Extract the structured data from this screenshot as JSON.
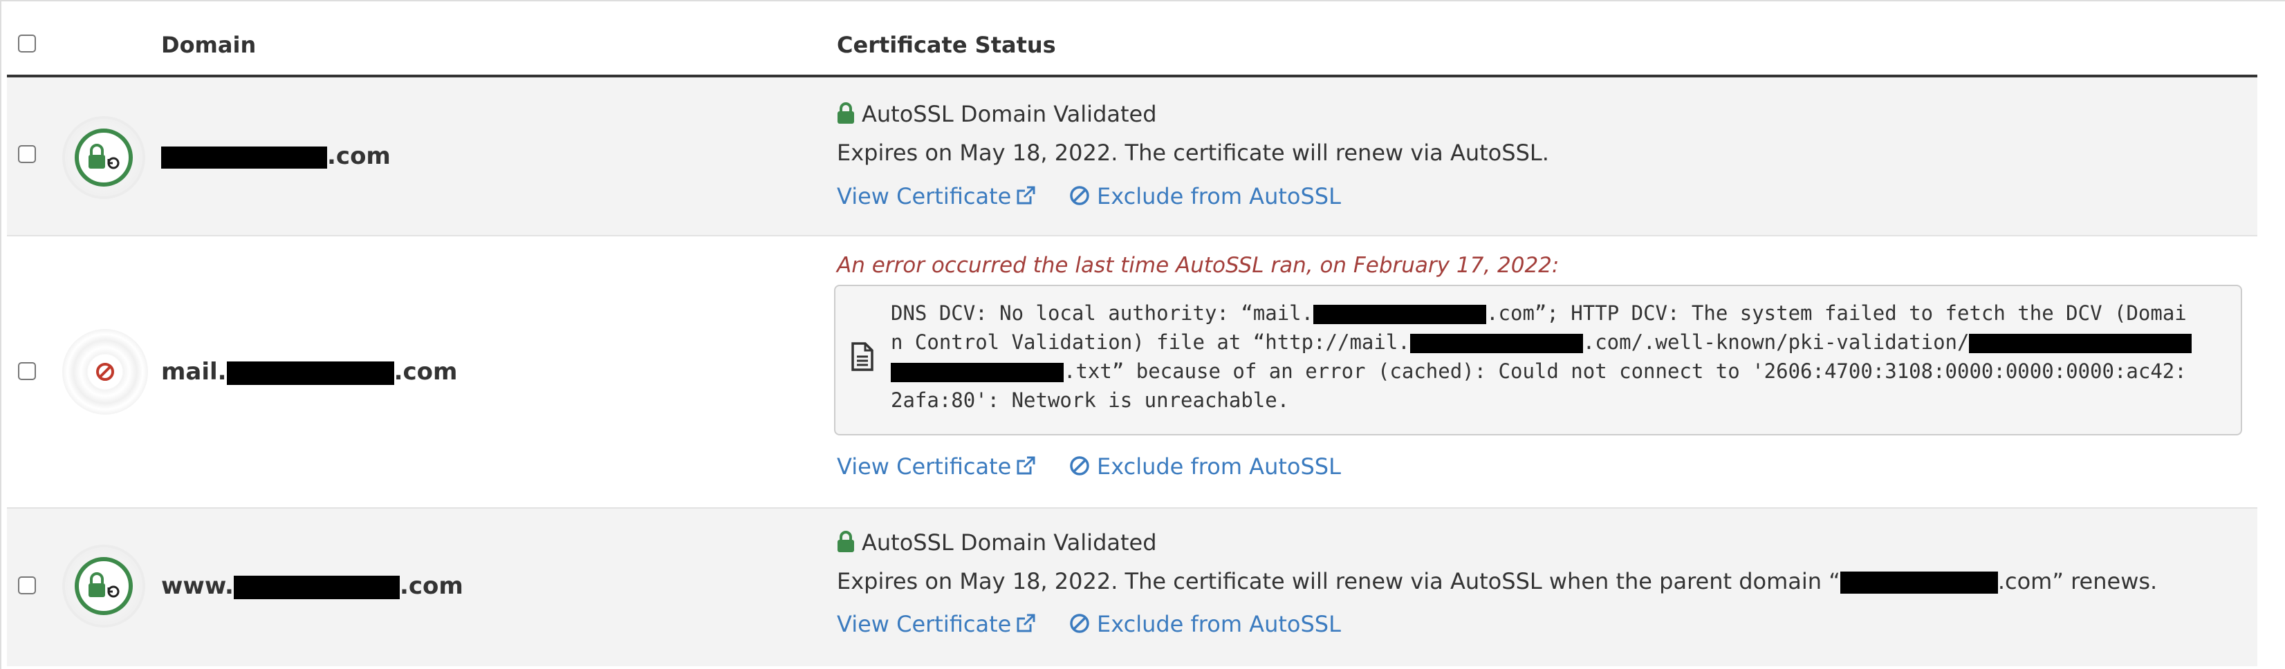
{
  "header": {
    "domain_label": "Domain",
    "status_label": "Certificate Status"
  },
  "colors": {
    "valid_green": "#3d8a4a",
    "error_red": "#a33f3b",
    "link_blue": "#3b7bbf",
    "row_grey": "#f3f3f3"
  },
  "rows": [
    {
      "domain_prefix": "",
      "domain_suffix": ".com",
      "status_icon": "lock-icon",
      "status_title": "AutoSSL Domain Validated",
      "status_text": "Expires on May 18, 2022. The certificate will renew via AutoSSL.",
      "view_label": "View Certificate",
      "exclude_label": "Exclude from AutoSSL"
    },
    {
      "domain_prefix": "mail.",
      "domain_suffix": ".com",
      "error_heading": "An error occurred the last time AutoSSL ran, on February 17, 2022:",
      "log": {
        "l1a": "DNS DCV: No local authority: “mail.",
        "l1b": ".com”; HTTP DCV: The system failed to fetch the DCV (Domai",
        "l2a": "n Control Validation) file at “http://mail.",
        "l2b": ".com/.well-known/pki-validation/",
        "l3b": ".txt” because of an error (cached): Could not connect to '2606:4700:3108:0000:0000:0000:ac42:",
        "l4": "2afa:80': Network is unreachable."
      },
      "view_label": "View Certificate",
      "exclude_label": "Exclude from AutoSSL"
    },
    {
      "domain_prefix": "www.",
      "domain_suffix": ".com",
      "status_icon": "lock-icon",
      "status_title": "AutoSSL Domain Validated",
      "status_text_a": "Expires on May 18, 2022. The certificate will renew via AutoSSL when the parent domain “",
      "status_text_b": ".com” renews.",
      "view_label": "View Certificate",
      "exclude_label": "Exclude from AutoSSL"
    }
  ]
}
